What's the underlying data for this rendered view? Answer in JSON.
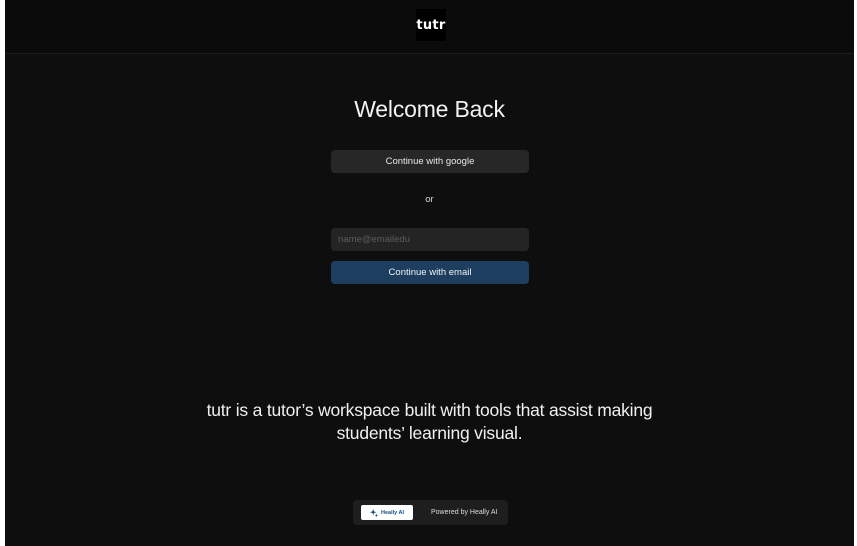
{
  "header": {
    "logo_text": "tutr"
  },
  "login": {
    "title": "Welcome Back",
    "google_button_label": "Continue with google",
    "divider_text": "or",
    "email_input": {
      "placeholder": "name@emailedu",
      "value": ""
    },
    "email_button_label": "Continue with email"
  },
  "tagline": {
    "line1": "tutr is a  tutor’s workspace built with tools that assist making",
    "line2": "students’ learning visual."
  },
  "footer_badge": {
    "pill_label": "Heally AI",
    "pill_icon": "sparkle-icon",
    "powered_text": "Powered by Heally AI"
  },
  "colors": {
    "background": "#0e0e0e",
    "google_button": "#272727",
    "email_button": "#1d3e5e",
    "badge_accent": "#1a4f86"
  }
}
